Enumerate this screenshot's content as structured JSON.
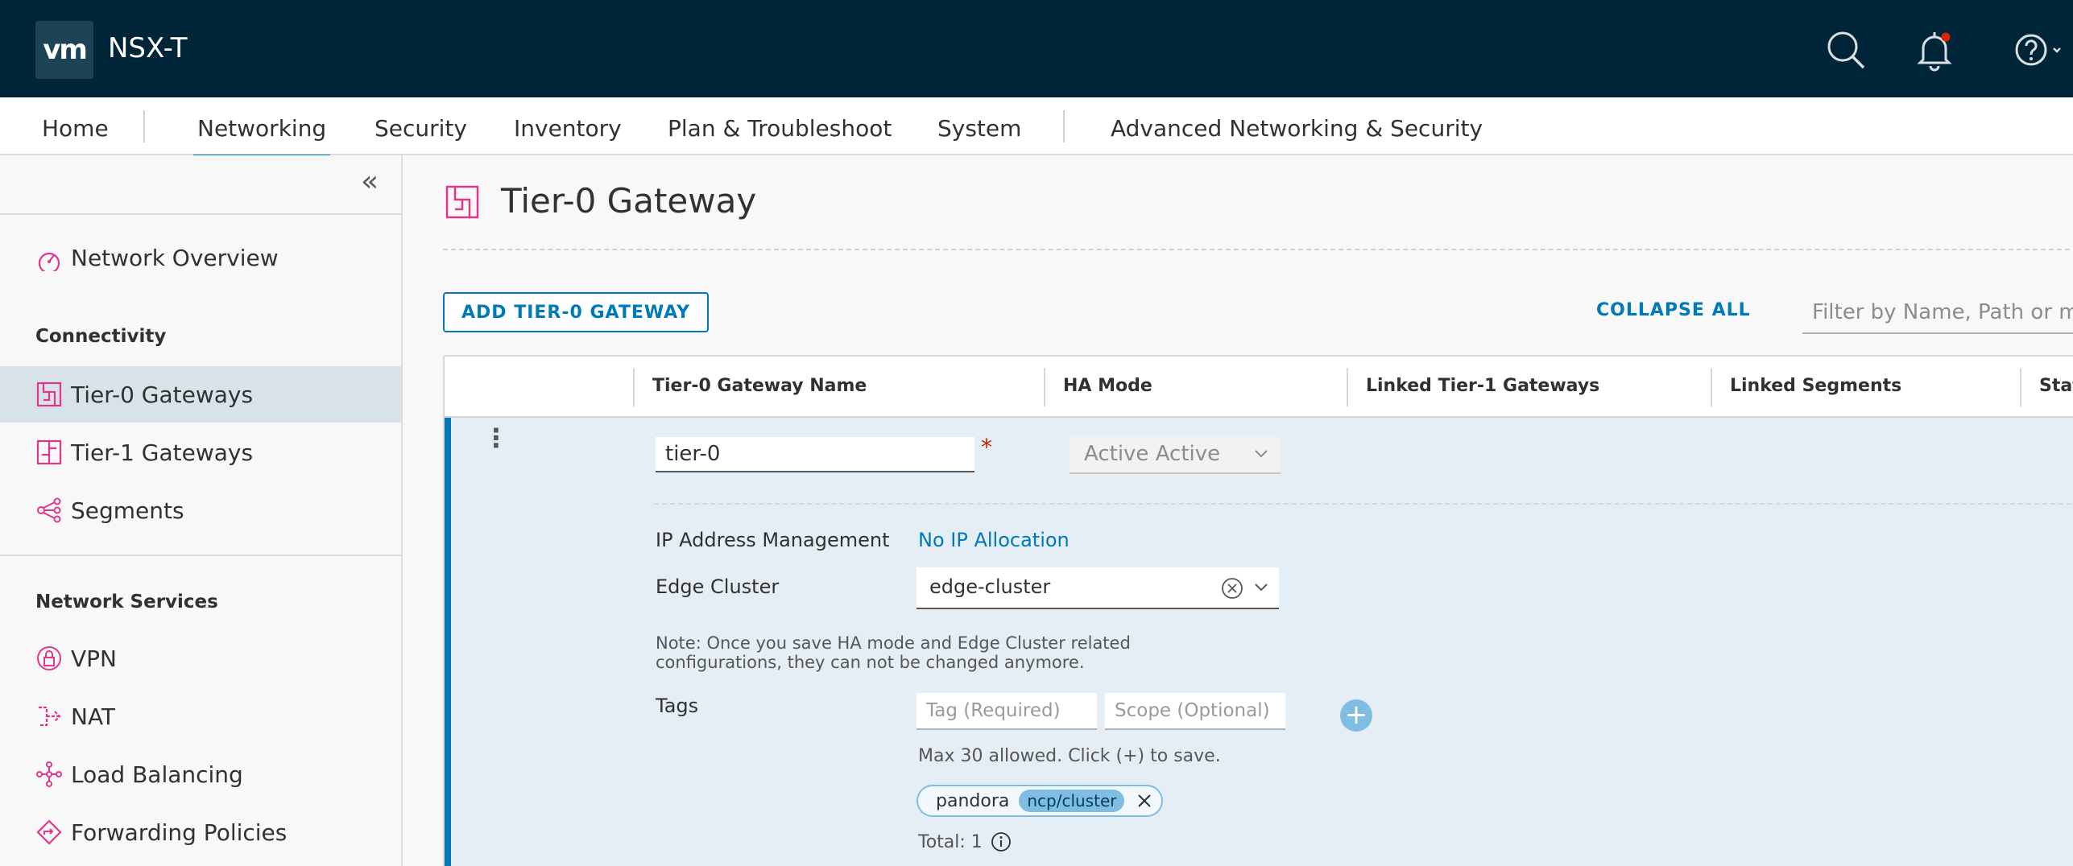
{
  "header": {
    "logo_text": "vm",
    "product_name": "NSX-T",
    "icons": [
      "search-icon",
      "bell-icon",
      "help-icon"
    ],
    "notification_dot_color": "#e12200"
  },
  "nav": {
    "tabs": [
      {
        "label": "Home"
      },
      {
        "label": "Networking",
        "active": true
      },
      {
        "label": "Security"
      },
      {
        "label": "Inventory"
      },
      {
        "label": "Plan & Troubleshoot"
      },
      {
        "label": "System"
      },
      {
        "label": "Advanced Networking & Security"
      }
    ]
  },
  "sidebar": {
    "overview": "Network Overview",
    "connectivity_heading": "Connectivity",
    "connectivity_items": [
      "Tier-0 Gateways",
      "Tier-1 Gateways",
      "Segments"
    ],
    "network_services_heading": "Network Services",
    "services_items": [
      "VPN",
      "NAT",
      "Load Balancing",
      "Forwarding Policies"
    ]
  },
  "page": {
    "title": "Tier-0 Gateway",
    "add_button": "ADD TIER-0 GATEWAY",
    "collapse_all": "COLLAPSE ALL",
    "filter_placeholder": "Filter by Name, Path or more"
  },
  "grid": {
    "columns": [
      "Tier-0 Gateway Name",
      "HA Mode",
      "Linked Tier-1 Gateways",
      "Linked Segments",
      "Status"
    ]
  },
  "form": {
    "name_value": "tier-0",
    "required_mark": "*",
    "ha_mode": "Active Active",
    "ipam_label": "IP Address Management",
    "ipam_value": "No IP Allocation",
    "edge_cluster_label": "Edge Cluster",
    "edge_cluster_value": "edge-cluster",
    "note": "Note: Once you save HA mode and Edge Cluster related configurations, they can not be changed anymore.",
    "tags_label": "Tags",
    "tag_placeholder": "Tag (Required)",
    "scope_placeholder": "Scope (Optional)",
    "tags_hint": "Max 30 allowed. Click (+) to save.",
    "tag_chip": {
      "tag": "pandora",
      "scope": "ncp/cluster"
    },
    "total": "Total: 1"
  },
  "colors": {
    "header_bg": "#002538",
    "accent": "#0079b8",
    "icon_pink": "#e0378b",
    "expanded_row_bg": "#e4eef4"
  }
}
